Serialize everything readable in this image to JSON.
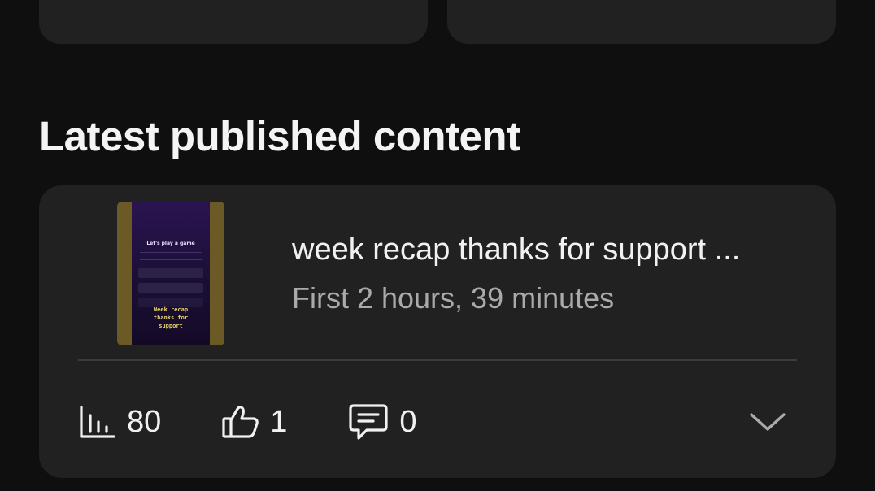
{
  "section": {
    "title": "Latest published content"
  },
  "content": {
    "thumbnail": {
      "heading": "Let's play a game",
      "caption": "Week recap\nthanks for\nsupport"
    },
    "title": "week recap thanks for support ...",
    "meta": "First 2 hours, 39 minutes",
    "stats": {
      "views": "80",
      "likes": "1",
      "comments": "0"
    },
    "icons": {
      "views": "bar-chart-icon",
      "likes": "thumbs-up-icon",
      "comments": "comment-icon",
      "expand": "chevron-down-icon"
    }
  },
  "colors": {
    "background": "#0f0f0f",
    "card": "#212121",
    "text_primary": "#f1f1f1",
    "text_secondary": "#aaaaaa"
  }
}
